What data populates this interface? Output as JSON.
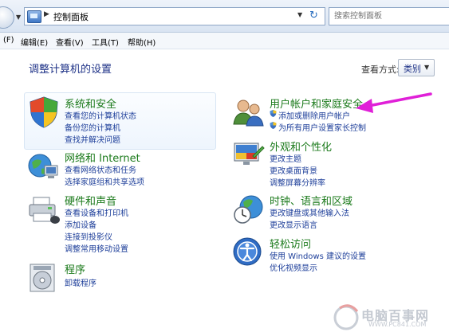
{
  "address_bar": {
    "path": "控制面板",
    "search_placeholder": "搜索控制面板"
  },
  "menu": {
    "file": "(F)",
    "edit": "编辑(E)",
    "view": "查看(V)",
    "tools": "工具(T)",
    "help": "帮助(H)"
  },
  "header": {
    "title": "调整计算机的设置",
    "view_by_label": "查看方式:",
    "view_by_value": "类别"
  },
  "categories_left": [
    {
      "title": "系统和安全",
      "links": [
        "查看您的计算机状态",
        "备份您的计算机",
        "查找并解决问题"
      ]
    },
    {
      "title": "网络和 Internet",
      "links": [
        "查看网络状态和任务",
        "选择家庭组和共享选项"
      ]
    },
    {
      "title": "硬件和声音",
      "links": [
        "查看设备和打印机",
        "添加设备",
        "连接到投影仪",
        "调整常用移动设置"
      ]
    },
    {
      "title": "程序",
      "links": [
        "卸载程序"
      ]
    }
  ],
  "categories_right": [
    {
      "title": "用户帐户和家庭安全",
      "links": [
        "添加或删除用户帐户",
        "为所有用户设置家长控制"
      ]
    },
    {
      "title": "外观和个性化",
      "links": [
        "更改主题",
        "更改桌面背景",
        "调整屏幕分辨率"
      ]
    },
    {
      "title": "时钟、语言和区域",
      "links": [
        "更改键盘或其他输入法",
        "更改显示语言"
      ]
    },
    {
      "title": "轻松访问",
      "links": [
        "使用 Windows 建议的设置",
        "优化视频显示"
      ]
    }
  ],
  "watermark": {
    "name": "电脑百事网",
    "url": "WWW.PC841.COM"
  },
  "colors": {
    "category_title": "#1b7a1b",
    "link": "#1e3f9a",
    "page_title": "#1e3287",
    "annotation_arrow": "#e020d8"
  }
}
